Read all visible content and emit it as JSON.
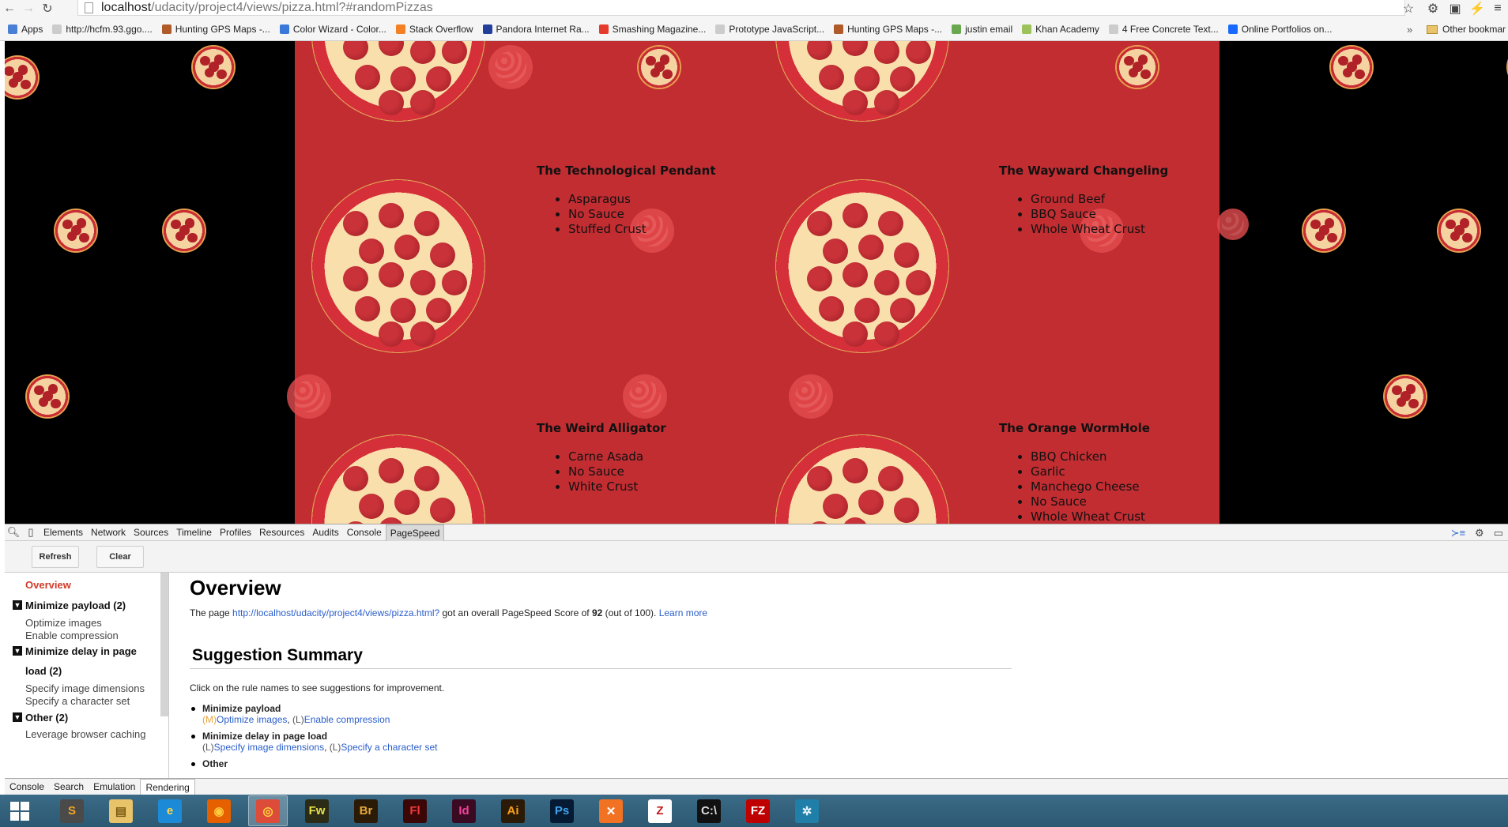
{
  "browser": {
    "url_host": "localhost",
    "url_path": "/udacity/project4/views/pizza.html?#randomPizzas"
  },
  "bookmarks": [
    {
      "label": "Apps",
      "color": "#4a7fd6"
    },
    {
      "label": "http://hcfm.93.ggo....",
      "color": "#cccccc"
    },
    {
      "label": "Hunting GPS Maps -...",
      "color": "#b05a2a"
    },
    {
      "label": "Color Wizard - Color...",
      "color": "#3a79d9"
    },
    {
      "label": "Stack Overflow",
      "color": "#f48024"
    },
    {
      "label": "Pandora Internet Ra...",
      "color": "#224099"
    },
    {
      "label": "Smashing Magazine...",
      "color": "#e53b2c"
    },
    {
      "label": "Prototype JavaScript...",
      "color": "#cccccc"
    },
    {
      "label": "Hunting GPS Maps -...",
      "color": "#b05a2a"
    },
    {
      "label": "justin email",
      "color": "#6aa84f"
    },
    {
      "label": "Khan Academy",
      "color": "#9cc259"
    },
    {
      "label": "4 Free Concrete Text...",
      "color": "#cccccc"
    },
    {
      "label": "Online Portfolios on...",
      "color": "#1769ff"
    }
  ],
  "bookmarks_more": "»",
  "other_bookmarks": "Other bookmar",
  "pizzas": [
    {
      "name": "The Technological Pendant",
      "ingredients": [
        "Asparagus",
        "No Sauce",
        "Stuffed Crust"
      ]
    },
    {
      "name": "The Wayward Changeling",
      "ingredients": [
        "Ground Beef",
        "BBQ Sauce",
        "Whole Wheat Crust"
      ]
    },
    {
      "name": "The Weird Alligator",
      "ingredients": [
        "Carne Asada",
        "No Sauce",
        "White Crust"
      ]
    },
    {
      "name": "The Orange WormHole",
      "ingredients": [
        "BBQ Chicken",
        "Garlic",
        "Manchego Cheese",
        "No Sauce",
        "Whole Wheat Crust"
      ]
    }
  ],
  "devtools": {
    "tabs": [
      "Elements",
      "Network",
      "Sources",
      "Timeline",
      "Profiles",
      "Resources",
      "Audits",
      "Console",
      "PageSpeed"
    ],
    "active_tab": "PageSpeed",
    "toolbar": {
      "refresh": "Refresh",
      "clear": "Clear"
    },
    "sidebar": {
      "overview": "Overview",
      "groups": [
        {
          "title": "Minimize payload (2)",
          "items": [
            "Optimize images",
            "Enable compression"
          ]
        },
        {
          "title": "Minimize delay in page",
          "title2": "load (2)",
          "items": [
            "Specify image dimensions",
            "Specify a character set"
          ]
        },
        {
          "title": "Other (2)",
          "items": [
            "Leverage browser caching"
          ]
        }
      ]
    },
    "overview": {
      "heading": "Overview",
      "score_prefix": "The page ",
      "score_url": "http://localhost/udacity/project4/views/pizza.html?",
      "score_mid": " got an overall PageSpeed Score of ",
      "score": "92",
      "score_suffix": " (out of 100). ",
      "learn_more": "Learn more",
      "summary_heading": "Suggestion Summary",
      "summary_intro": "Click on the rule names to see suggestions for improvement.",
      "rules": [
        {
          "title": "Minimize payload",
          "items": [
            {
              "p": "(M)",
              "label": "Optimize images"
            },
            {
              "p": "(L)",
              "label": "Enable compression"
            }
          ]
        },
        {
          "title": "Minimize delay in page load",
          "items": [
            {
              "p": "(L)",
              "label": "Specify image dimensions"
            },
            {
              "p": "(L)",
              "label": "Specify a character set"
            }
          ]
        },
        {
          "title": "Other"
        }
      ]
    },
    "drawer_tabs": [
      "Console",
      "Search",
      "Emulation",
      "Rendering"
    ],
    "drawer_active": "Rendering"
  },
  "taskbar": [
    {
      "name": "sublime-text-app",
      "label": "S",
      "bg": "#4a4a4a",
      "fg": "#f5a623"
    },
    {
      "name": "file-explorer-app",
      "label": "▤",
      "bg": "#e8c36a",
      "fg": "#7a5a12"
    },
    {
      "name": "internet-explorer-app",
      "label": "e",
      "bg": "#1c8ad6",
      "fg": "#ffd84a"
    },
    {
      "name": "firefox-app",
      "label": "◉",
      "bg": "#e66000",
      "fg": "#ffcb3d"
    },
    {
      "name": "chrome-app",
      "label": "◎",
      "bg": "#dd4b39",
      "fg": "#ffd83b"
    },
    {
      "name": "fireworks-app",
      "label": "Fw",
      "bg": "#2b2b16",
      "fg": "#e5e14a"
    },
    {
      "name": "bridge-app",
      "label": "Br",
      "bg": "#2a1a06",
      "fg": "#e6a83b"
    },
    {
      "name": "flash-app",
      "label": "Fl",
      "bg": "#3a0606",
      "fg": "#ee3b3b"
    },
    {
      "name": "indesign-app",
      "label": "Id",
      "bg": "#3a0a22",
      "fg": "#f0449a"
    },
    {
      "name": "illustrator-app",
      "label": "Ai",
      "bg": "#2b1a06",
      "fg": "#f7a11a"
    },
    {
      "name": "photoshop-app",
      "label": "Ps",
      "bg": "#061a33",
      "fg": "#3ea6f0"
    },
    {
      "name": "xampp-app",
      "label": "✕",
      "bg": "#f27224",
      "fg": "#ffffff"
    },
    {
      "name": "filezilla-server-app",
      "label": "Z",
      "bg": "#ffffff",
      "fg": "#c21a1a"
    },
    {
      "name": "command-prompt-app",
      "label": "C:\\",
      "bg": "#111111",
      "fg": "#dddddd"
    },
    {
      "name": "filezilla-app",
      "label": "FZ",
      "bg": "#bf0000",
      "fg": "#ffffff"
    },
    {
      "name": "network-app",
      "label": "✲",
      "bg": "#1f7fa8",
      "fg": "#e7f6ff"
    }
  ],
  "taskbar_active": "chrome-app"
}
